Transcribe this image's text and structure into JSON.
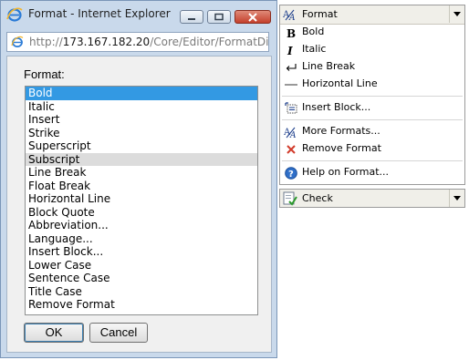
{
  "window": {
    "title": "Format - Internet Explorer",
    "icon": "ie-icon",
    "controls": [
      "minimize-icon",
      "restore-icon",
      "close-icon"
    ]
  },
  "address_bar": {
    "protocol": "http://",
    "host": "173.167.182.20",
    "path": "/Core/Editor/FormatDialog"
  },
  "dialog": {
    "format_label": "Format:",
    "selected_item": "Bold",
    "hover_item": "Subscript",
    "items": [
      "Bold",
      "Italic",
      "Insert",
      "Strike",
      "Superscript",
      "Subscript",
      "Line Break",
      "Float Break",
      "Horizontal Line",
      "Block Quote",
      "Abbreviation...",
      "Language...",
      "Insert Block...",
      "Lower Case",
      "Sentence Case",
      "Title Case",
      "Remove Format"
    ],
    "ok_label": "OK",
    "cancel_label": "Cancel"
  },
  "format_menu": {
    "header": {
      "label": "Format",
      "icon": "format-icon"
    },
    "items": [
      {
        "label": "Bold",
        "icon": "bold-icon"
      },
      {
        "label": "Italic",
        "icon": "italic-icon"
      },
      {
        "label": "Line Break",
        "icon": "line-break-icon"
      },
      {
        "label": "Horizontal Line",
        "icon": "horizontal-line-icon"
      },
      {
        "label": "Insert Block...",
        "icon": "insert-block-icon"
      },
      {
        "label": "More Formats...",
        "icon": "more-formats-icon"
      },
      {
        "label": "Remove Format",
        "icon": "remove-format-icon"
      },
      {
        "label": "Help on Format...",
        "icon": "help-icon"
      }
    ]
  },
  "check_bar": {
    "label": "Check",
    "icon": "check-icon"
  },
  "colors": {
    "selection": "#3399e3",
    "hover": "#dcdcdc",
    "window_frame": "#c9d9eb",
    "remove_icon": "#d23b2b",
    "help_icon": "#2f6fc8"
  }
}
